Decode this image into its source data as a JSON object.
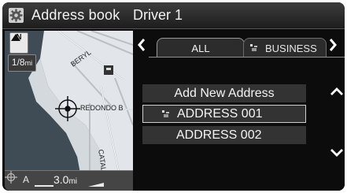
{
  "title_bar": {
    "title": "Address book",
    "driver": "Driver 1",
    "icon": "gear-icon"
  },
  "map": {
    "compass_letter": "N",
    "zoom_scale": "1/8",
    "zoom_unit": "mi",
    "streets": [
      "BERYL",
      "REDONDO B",
      "CATALINA"
    ],
    "bottom_mode": "A",
    "bottom_scale": "3.0",
    "bottom_unit": "mi"
  },
  "tabs": {
    "prev_icon": "chevron-left-icon",
    "next_icon": "chevron-right-icon",
    "items": [
      {
        "label": "ALL",
        "selected": true
      },
      {
        "label": "BUSINESS",
        "selected": false,
        "icon": "business-category-icon"
      }
    ]
  },
  "list": {
    "add_label": "Add New Address",
    "items": [
      {
        "label": "ADDRESS 001",
        "icon": "business-category-icon",
        "highlighted": true
      },
      {
        "label": "ADDRESS 002",
        "highlighted": false
      }
    ]
  },
  "scroll": {
    "up_icon": "scroll-up-icon",
    "down_icon": "scroll-down-icon"
  }
}
